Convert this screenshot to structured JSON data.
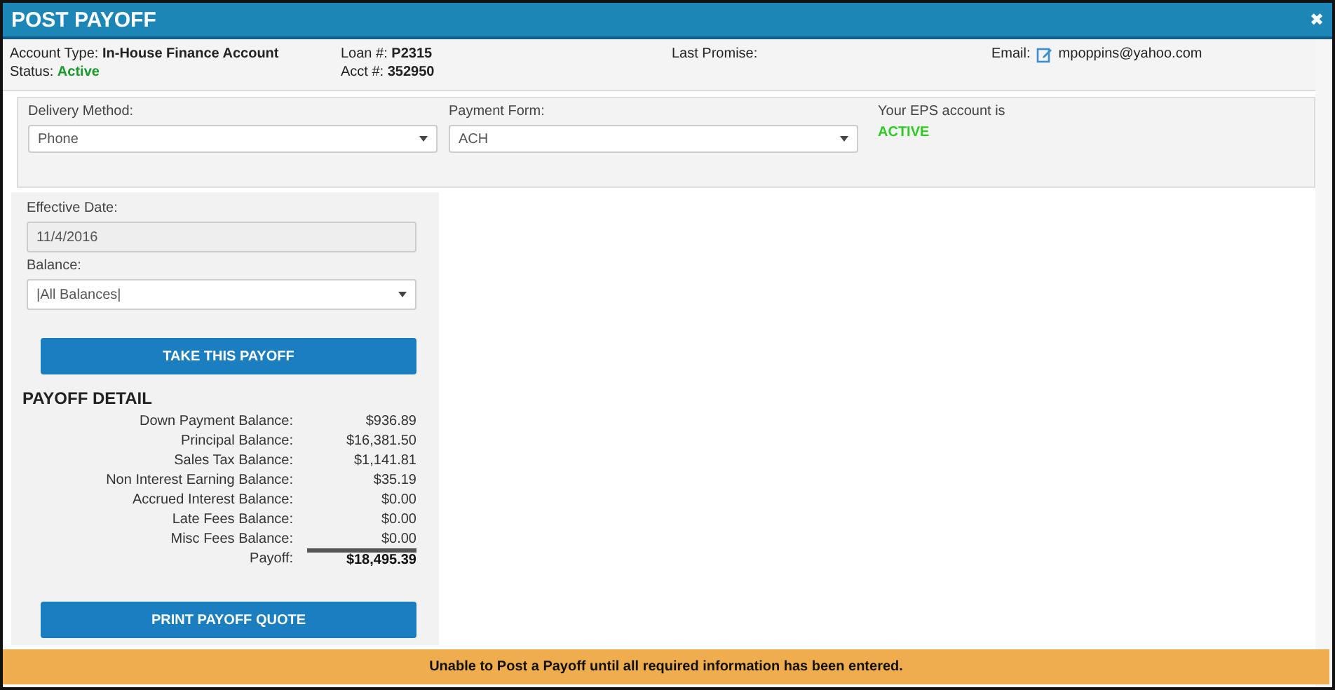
{
  "window": {
    "title": "POST PAYOFF",
    "close": "✖"
  },
  "account": {
    "type_label": "Account Type:",
    "type": "In-House Finance Account",
    "status_label": "Status:",
    "status": "Active",
    "loan_label": "Loan #:",
    "loan": "P2315",
    "acct_label": "Acct #:",
    "acct": "352950",
    "promise_label": "Last Promise:",
    "email_label": "Email:",
    "email": "mpoppins@yahoo.com"
  },
  "delivery": {
    "label": "Delivery Method:",
    "value": "Phone"
  },
  "payment_form": {
    "label": "Payment Form:",
    "value": "ACH"
  },
  "eps": {
    "text": "Your EPS account is",
    "status": "ACTIVE"
  },
  "effective_date": {
    "label": "Effective Date:",
    "value": "11/4/2016"
  },
  "balance": {
    "label": "Balance:",
    "value": "|All Balances|"
  },
  "take_button": "TAKE THIS PAYOFF",
  "detail": {
    "title": "PAYOFF DETAIL",
    "rows": [
      {
        "label": "Down Payment Balance:",
        "value": "$936.89"
      },
      {
        "label": "Principal Balance:",
        "value": "$16,381.50"
      },
      {
        "label": "Sales Tax Balance:",
        "value": "$1,141.81"
      },
      {
        "label": "Non Interest Earning Balance:",
        "value": "$35.19"
      },
      {
        "label": "Accrued Interest Balance:",
        "value": "$0.00"
      },
      {
        "label": "Late Fees Balance:",
        "value": "$0.00"
      },
      {
        "label": "Misc Fees Balance:",
        "value": "$0.00"
      }
    ],
    "total": {
      "label": "Payoff:",
      "value": "$18,495.39"
    }
  },
  "print_button": "PRINT PAYOFF QUOTE",
  "warning": "Unable to Post a Payoff until all required information has been entered."
}
